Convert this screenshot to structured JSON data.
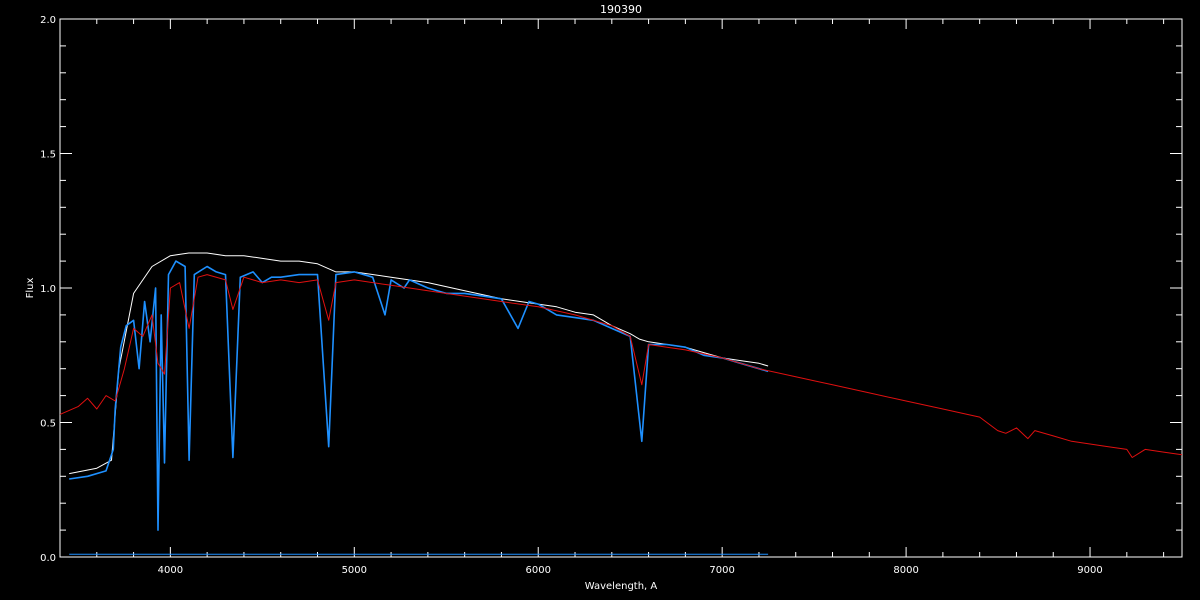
{
  "chart_data": {
    "type": "line",
    "title": "190390",
    "xlabel": "Wavelength, A",
    "ylabel": "Flux",
    "xlim": [
      3400,
      9500
    ],
    "ylim": [
      0,
      2.0
    ],
    "x_ticks": [
      4000,
      5000,
      6000,
      7000,
      8000,
      9000
    ],
    "y_ticks": [
      0.0,
      0.5,
      1.0,
      1.5,
      2.0
    ],
    "x_tick_labels": [
      "4000",
      "5000",
      "6000",
      "7000",
      "8000",
      "9000"
    ],
    "y_tick_labels": [
      "0.0",
      "0.5",
      "1.0",
      "1.5",
      "2.0"
    ],
    "grid": false,
    "background": "#000000",
    "axis_color": "#ffffff",
    "series": [
      {
        "color": "#ffffff",
        "x": [
          3450,
          3600,
          3680,
          3720,
          3800,
          3900,
          4000,
          4100,
          4200,
          4300,
          4400,
          4500,
          4600,
          4700,
          4800,
          4900,
          5000,
          5200,
          5400,
          5600,
          5800,
          6000,
          6100,
          6200,
          6300,
          6400,
          6500,
          6550,
          6600,
          6700,
          6800,
          6900,
          7000,
          7100,
          7200,
          7250
        ],
        "y": [
          0.31,
          0.33,
          0.36,
          0.7,
          0.98,
          1.08,
          1.12,
          1.13,
          1.13,
          1.12,
          1.12,
          1.11,
          1.1,
          1.1,
          1.09,
          1.06,
          1.06,
          1.04,
          1.02,
          0.99,
          0.96,
          0.94,
          0.93,
          0.91,
          0.9,
          0.86,
          0.83,
          0.81,
          0.8,
          0.79,
          0.78,
          0.76,
          0.74,
          0.73,
          0.72,
          0.71
        ]
      },
      {
        "color": "#1e90ff",
        "x": [
          3450,
          3550,
          3650,
          3690,
          3700,
          3730,
          3760,
          3800,
          3830,
          3860,
          3890,
          3920,
          3933,
          3950,
          3968,
          3990,
          4030,
          4080,
          4102,
          4130,
          4200,
          4250,
          4300,
          4340,
          4380,
          4450,
          4500,
          4550,
          4600,
          4700,
          4800,
          4861,
          4900,
          5000,
          5100,
          5167,
          5200,
          5270,
          5300,
          5400,
          5500,
          5600,
          5700,
          5800,
          5890,
          5950,
          6000,
          6100,
          6200,
          6300,
          6400,
          6500,
          6563,
          6600,
          6700,
          6800,
          6900,
          7000,
          7100,
          7200,
          7250
        ],
        "y": [
          0.29,
          0.3,
          0.32,
          0.4,
          0.55,
          0.78,
          0.86,
          0.88,
          0.7,
          0.95,
          0.8,
          1.0,
          0.1,
          0.9,
          0.35,
          1.05,
          1.1,
          1.08,
          0.36,
          1.05,
          1.08,
          1.06,
          1.05,
          0.37,
          1.04,
          1.06,
          1.02,
          1.04,
          1.04,
          1.05,
          1.05,
          0.41,
          1.05,
          1.06,
          1.04,
          0.9,
          1.03,
          1.0,
          1.03,
          1.0,
          0.98,
          0.98,
          0.97,
          0.96,
          0.85,
          0.95,
          0.94,
          0.9,
          0.89,
          0.88,
          0.85,
          0.82,
          0.43,
          0.79,
          0.79,
          0.78,
          0.75,
          0.74,
          0.72,
          0.7,
          0.69
        ]
      },
      {
        "color": "#e01010",
        "x": [
          3400,
          3500,
          3550,
          3600,
          3650,
          3700,
          3750,
          3800,
          3850,
          3900,
          3933,
          3968,
          4000,
          4050,
          4102,
          4150,
          4200,
          4300,
          4340,
          4400,
          4500,
          4600,
          4700,
          4800,
          4861,
          4900,
          5000,
          5200,
          5400,
          5600,
          5800,
          6000,
          6200,
          6400,
          6500,
          6563,
          6600,
          6700,
          6800,
          7000,
          7200,
          7400,
          7600,
          7800,
          8000,
          8200,
          8400,
          8498,
          8542,
          8600,
          8662,
          8700,
          8800,
          8900,
          9000,
          9100,
          9200,
          9229,
          9300,
          9400,
          9500
        ],
        "y": [
          0.53,
          0.56,
          0.59,
          0.55,
          0.6,
          0.58,
          0.7,
          0.85,
          0.82,
          0.9,
          0.72,
          0.68,
          1.0,
          1.02,
          0.85,
          1.04,
          1.05,
          1.03,
          0.92,
          1.04,
          1.02,
          1.03,
          1.02,
          1.03,
          0.88,
          1.02,
          1.03,
          1.01,
          0.99,
          0.97,
          0.95,
          0.93,
          0.9,
          0.86,
          0.82,
          0.64,
          0.79,
          0.78,
          0.77,
          0.74,
          0.7,
          0.67,
          0.64,
          0.61,
          0.58,
          0.55,
          0.52,
          0.47,
          0.46,
          0.48,
          0.44,
          0.47,
          0.45,
          0.43,
          0.42,
          0.41,
          0.4,
          0.37,
          0.4,
          0.39,
          0.38
        ]
      },
      {
        "color": "#1e90ff",
        "x": [
          3450,
          4000,
          5000,
          6000,
          7000,
          7250
        ],
        "y": [
          0.01,
          0.01,
          0.01,
          0.01,
          0.01,
          0.01
        ]
      }
    ]
  }
}
